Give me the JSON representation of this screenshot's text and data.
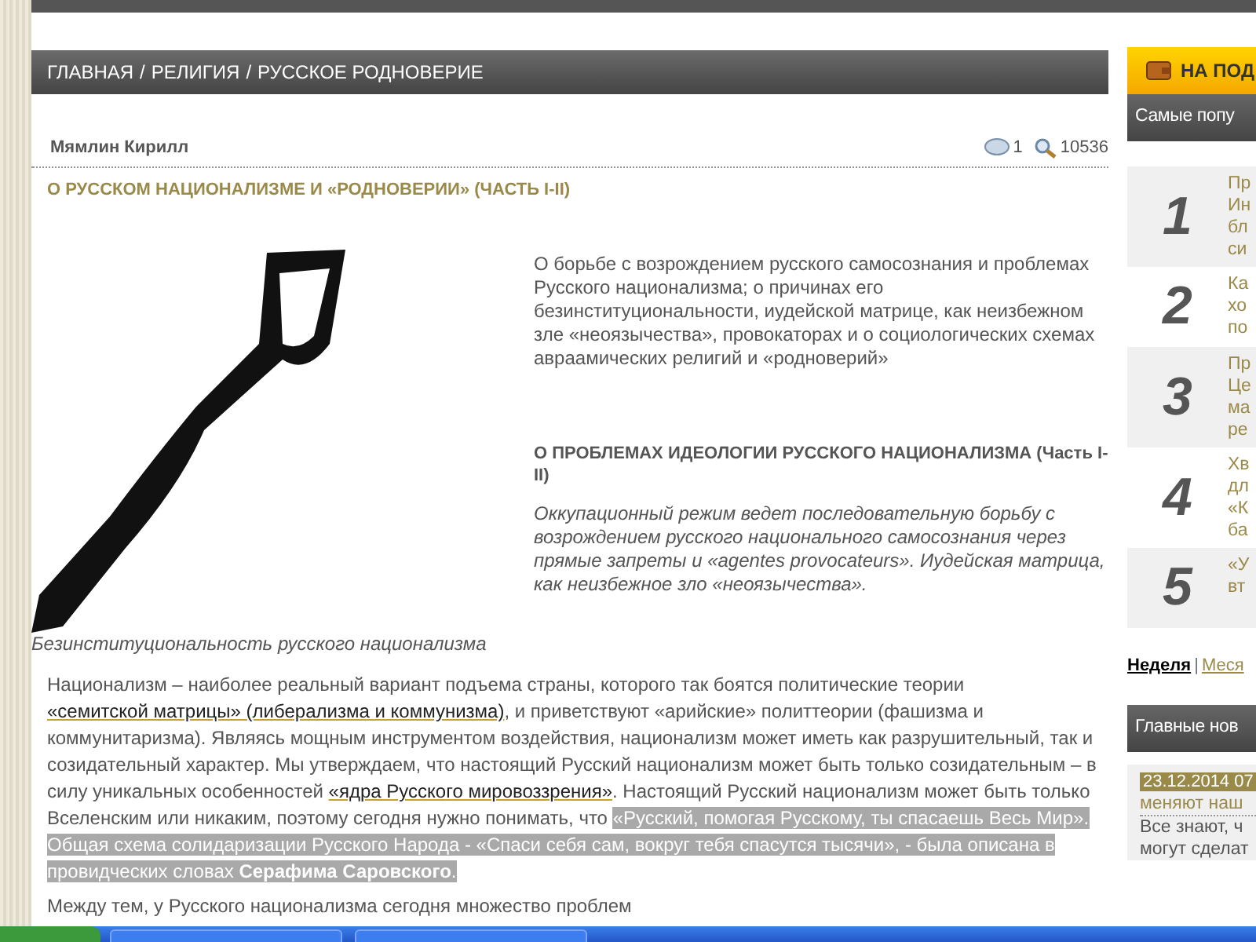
{
  "breadcrumb": [
    "ГЛАВНАЯ",
    "РЕЛИГИЯ",
    "РУССКОЕ РОДНОВЕРИЕ"
  ],
  "breadcrumb_separator": "/",
  "article": {
    "author": "Мямлин Кирилл",
    "comments": "1",
    "views": "10536",
    "title": "О РУССКОМ НАЦИОНАЛИЗМЕ И «РОДНОВЕРИИ» (ЧАСТЬ I-II)",
    "intro": "О борьбе с возрождением русского самосознания и проблемах Русского национализма; о причинах его безинституциональности,  иудейской матрице, как неизбежном зле «неоязычества», провокаторах и о социологических схемах авраамических религий и «родноверий»",
    "subtitle": "О ПРОБЛЕМАХ ИДЕОЛОГИИ РУССКОГО НАЦИОНАЛИЗМА (Часть I-II)",
    "quote": "Оккупационный режим ведет последовательную борьбу с возрождением русского национального самосознания через прямые запреты и «agentes provocateurs». Иудейская матрица, как неизбежное зло «неоязычества».",
    "quote_tail": "Безинституциональность русского национализма",
    "body": [
      {
        "kind": "text",
        "text": "Национализм – наиболее реальный вариант подъема страны, которого так боятся политические теории "
      },
      {
        "kind": "link",
        "text": "«семитской матрицы» (либерализма и коммунизма)"
      },
      {
        "kind": "text",
        "text": ", и приветствуют «арийские» политтеории (фашизма и коммунитаризма). Являясь мощным инструментом воздействия, национализм может иметь как разрушительный, так и созидательный характер. Мы утверждаем, что настоящий Русский национализм может быть только созидательным – в силу уникальных особенностей "
      },
      {
        "kind": "link",
        "text": "«ядра Русского мировоззрения»"
      },
      {
        "kind": "text",
        "text": ". Настоящий Русский национализм может быть только Вселенским или никаким, поэтому сегодня нужно понимать, что "
      },
      {
        "kind": "highlight",
        "text": "«Русский, помогая Русскому, ты спасаешь Весь Мир». Общая схема солидаризации Русского Народа - «Спаси себя сам, вокруг тебя спасутся тысячи», - была описана в провидческих словах **Серафима Саровского**."
      }
    ],
    "next": "Между тем, у Русского национализма сегодня множество проблем"
  },
  "sidebar": {
    "banner": "НА ПОД",
    "popular_title": "Самые попу",
    "popular": [
      {
        "rank": "1",
        "lines": [
          "Пр",
          "Ин",
          "бл",
          "си"
        ]
      },
      {
        "rank": "2",
        "lines": [
          "Ка",
          "хо",
          "по"
        ]
      },
      {
        "rank": "3",
        "lines": [
          "Пр",
          "Це",
          "ма",
          "ре"
        ]
      },
      {
        "rank": "4",
        "lines": [
          "Хв",
          "дл",
          "«К",
          "ба"
        ]
      },
      {
        "rank": "5",
        "lines": [
          "«У",
          "вт"
        ]
      }
    ],
    "periods": [
      {
        "label": "Неделя",
        "selected": true
      },
      {
        "label": "Меся",
        "selected": false
      }
    ],
    "period_separator": "|",
    "news_title": "Главные нов",
    "news": {
      "date": "23.12.2014 07",
      "headline": "меняют наш",
      "lines": [
        "Все знают, ч",
        "могут сделат"
      ]
    }
  }
}
